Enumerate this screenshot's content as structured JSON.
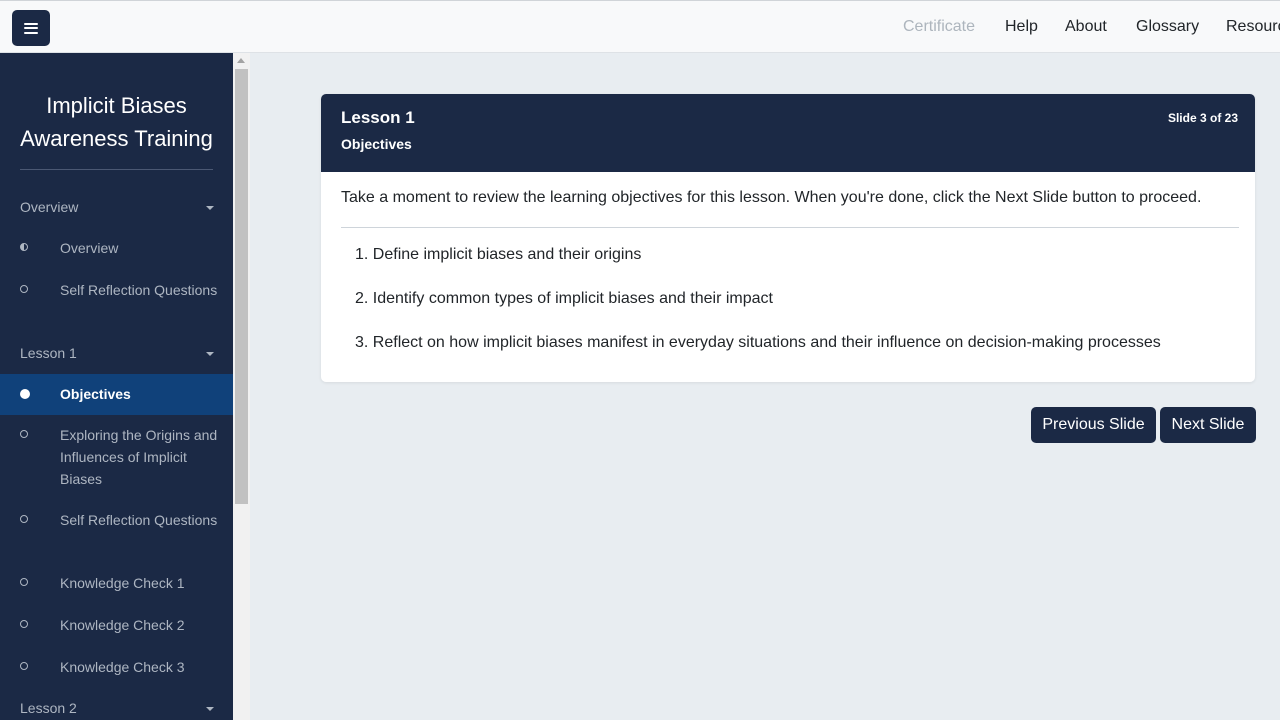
{
  "topnav": {
    "certificate": "Certificate",
    "help": "Help",
    "about": "About",
    "glossary": "Glossary",
    "resources": "Resources"
  },
  "sidebar": {
    "title": "Implicit Biases Awareness Training",
    "overview_section": "Overview",
    "overview_items": [
      "Overview",
      "Self Reflection Questions"
    ],
    "lesson1_section": "Lesson 1",
    "lesson1_items": [
      "Objectives",
      "Exploring the Origins and Influences of Implicit Biases",
      "Self Reflection Questions",
      "Knowledge Check 1",
      "Knowledge Check 2",
      "Knowledge Check 3"
    ],
    "lesson2_section": "Lesson 2"
  },
  "card": {
    "lesson": "Lesson 1",
    "subtitle": "Objectives",
    "slide_counter": "Slide 3 of 23",
    "intro": "Take a moment to review the learning objectives for this lesson. When you're done, click the Next Slide button to proceed.",
    "objectives": [
      "1. Define implicit biases and their origins",
      "2. Identify common types of implicit biases and their impact",
      "3. Reflect on how implicit biases manifest in everyday situations and their influence on decision-making processes"
    ]
  },
  "buttons": {
    "previous": "Previous Slide",
    "next": "Next Slide"
  },
  "colors": {
    "navy": "#1b2945",
    "active_item": "#10417a",
    "page_bg": "#e8edf1"
  }
}
